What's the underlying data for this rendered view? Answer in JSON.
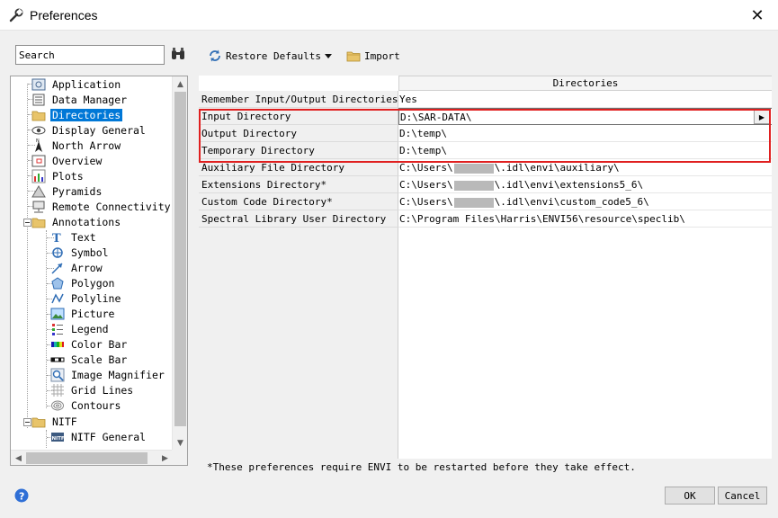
{
  "window": {
    "title": "Preferences",
    "close_glyph": "✕"
  },
  "search": {
    "value": "Search"
  },
  "toolbar": {
    "restore_label": "Restore Defaults",
    "import_label": "Import"
  },
  "tree": {
    "items": [
      {
        "label": "Application"
      },
      {
        "label": "Data Manager"
      },
      {
        "label": "Directories"
      },
      {
        "label": "Display General"
      },
      {
        "label": "North Arrow"
      },
      {
        "label": "Overview"
      },
      {
        "label": "Plots"
      },
      {
        "label": "Pyramids"
      },
      {
        "label": "Remote Connectivity"
      },
      {
        "label": "Annotations"
      },
      {
        "label": "Text"
      },
      {
        "label": "Symbol"
      },
      {
        "label": "Arrow"
      },
      {
        "label": "Polygon"
      },
      {
        "label": "Polyline"
      },
      {
        "label": "Picture"
      },
      {
        "label": "Legend"
      },
      {
        "label": "Color Bar"
      },
      {
        "label": "Scale Bar"
      },
      {
        "label": "Image Magnifier"
      },
      {
        "label": "Grid Lines"
      },
      {
        "label": "Contours"
      },
      {
        "label": "NITF"
      },
      {
        "label": "NITF General"
      }
    ],
    "selected": "Directories"
  },
  "grid": {
    "header": "Directories",
    "rows": [
      {
        "label": "Remember Input/Output Directories",
        "value": "Yes"
      },
      {
        "label": "Input Directory",
        "value": "D:\\SAR-DATA\\"
      },
      {
        "label": "Output Directory",
        "value": "D:\\temp\\"
      },
      {
        "label": "Temporary Directory",
        "value": "D:\\temp\\"
      },
      {
        "label": "Auxiliary File Directory",
        "value_prefix": "C:\\Users\\",
        "value_suffix": "\\.idl\\envi\\auxiliary\\"
      },
      {
        "label": "Extensions Directory*",
        "value_prefix": "C:\\Users\\",
        "value_suffix": "\\.idl\\envi\\extensions5_6\\"
      },
      {
        "label": "Custom Code Directory*",
        "value_prefix": "C:\\Users\\",
        "value_suffix": "\\.idl\\envi\\custom_code5_6\\"
      },
      {
        "label": "Spectral Library User Directory",
        "value": "C:\\Program Files\\Harris\\ENVI56\\resource\\speclib\\"
      }
    ]
  },
  "footnote": "*These preferences require ENVI to be restarted before they take effect.",
  "buttons": {
    "ok": "OK",
    "cancel": "Cancel"
  },
  "colors": {
    "selection": "#0078d7",
    "highlight_box": "#e02020"
  },
  "icons": [
    "wrench-icon",
    "binoculars-icon",
    "refresh-icon",
    "folder-icon",
    "help-icon"
  ]
}
